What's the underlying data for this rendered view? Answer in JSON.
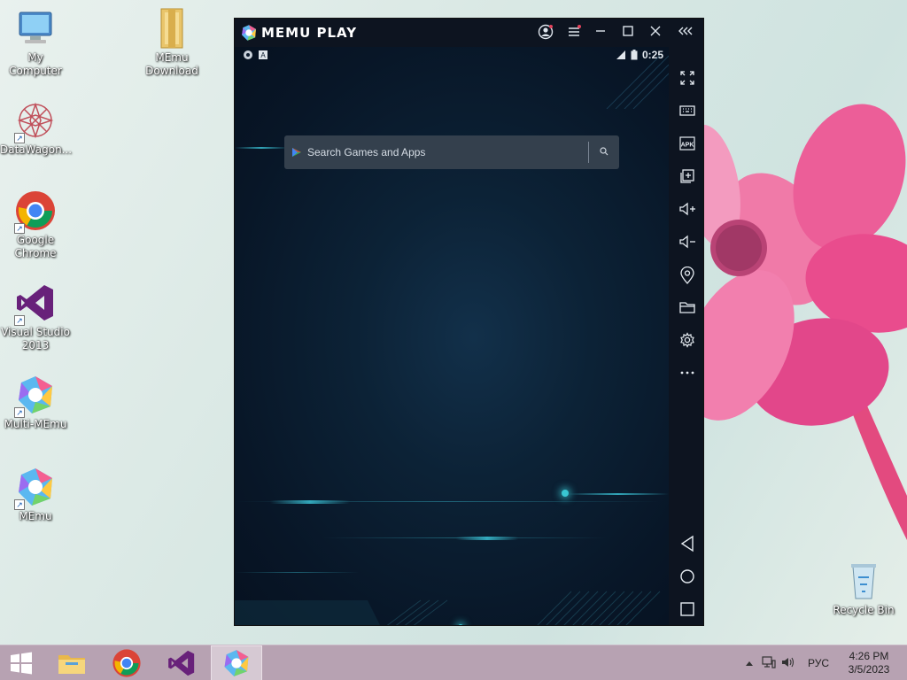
{
  "desktop": {
    "icons": [
      {
        "label": "My Computer",
        "icon": "computer-icon"
      },
      {
        "label": "MEmu\nDownload",
        "icon": "folder-icon"
      },
      {
        "label": "DataWagon...",
        "icon": "datawagon-icon"
      },
      {
        "label": "Google\nChrome",
        "icon": "chrome-icon"
      },
      {
        "label": "Visual Studio\n2013",
        "icon": "visual-studio-icon"
      },
      {
        "label": "Multi-MEmu",
        "icon": "multi-memu-icon"
      },
      {
        "label": "MEmu",
        "icon": "memu-icon"
      },
      {
        "label": "Recycle Bin",
        "icon": "recycle-bin-icon"
      }
    ]
  },
  "memu": {
    "title": "MEMU PLAY",
    "status": {
      "time": "0:25"
    },
    "search": {
      "placeholder": "Search Games and Apps"
    },
    "sidebar_tools": [
      "fullscreen-icon",
      "keyboard-icon",
      "apk-icon",
      "multi-instance-icon",
      "volume-up-icon",
      "volume-down-icon",
      "location-icon",
      "folder-icon",
      "settings-icon",
      "more-icon"
    ],
    "sidebar_apk_label": "APK",
    "nav": [
      "back-icon",
      "home-icon",
      "recents-icon"
    ]
  },
  "taskbar": {
    "apps": [
      "start-icon",
      "file-explorer-icon",
      "chrome-icon",
      "visual-studio-icon",
      "memu-icon"
    ],
    "language": "РУС",
    "time": "4:26 PM",
    "date": "3/5/2023"
  },
  "colors": {
    "flower_pink": "#e84a8f",
    "taskbar": "#b7a2b2",
    "memu_bg": "#0b1a2c"
  }
}
